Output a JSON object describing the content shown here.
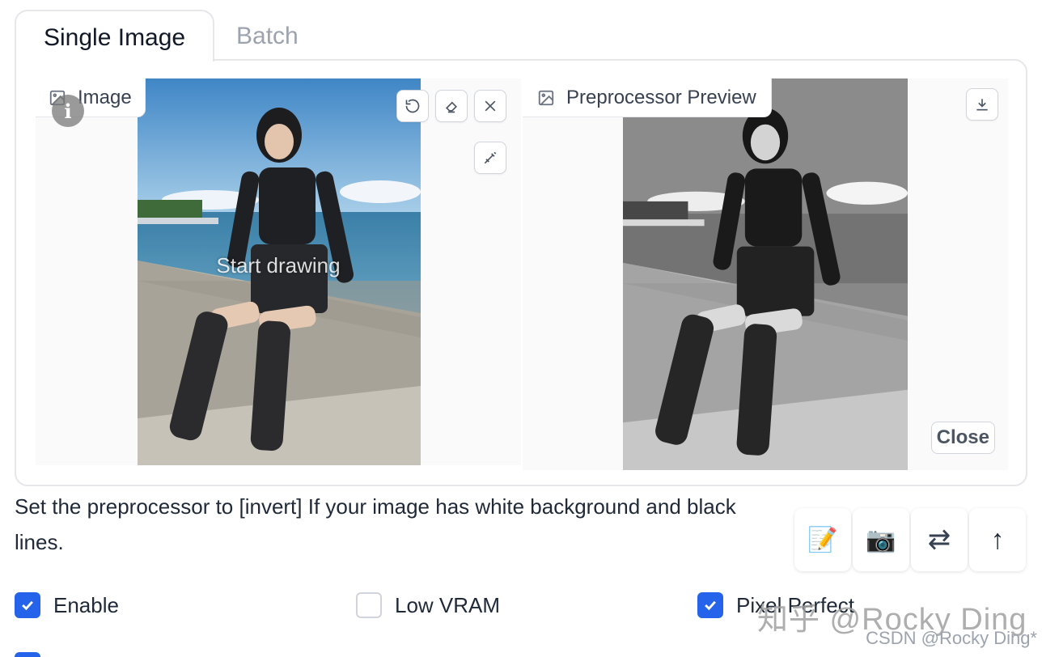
{
  "tabs": [
    {
      "label": "Single Image",
      "active": true
    },
    {
      "label": "Batch",
      "active": false
    }
  ],
  "image_panel": {
    "label": "Image",
    "overlay_text": "Start drawing",
    "info_glyph": "i",
    "tools": [
      "undo-icon",
      "eraser-icon",
      "close-icon",
      "brush-icon"
    ]
  },
  "preview_panel": {
    "label": "Preprocessor Preview",
    "close_label": "Close",
    "tools": [
      "download-icon"
    ]
  },
  "hint": "Set the preprocessor to [invert] If your image has white background and black lines.",
  "actions": [
    {
      "name": "notepad-icon",
      "glyph": "📝"
    },
    {
      "name": "camera-icon",
      "glyph": "📷"
    },
    {
      "name": "swap-icon",
      "glyph": "⇄"
    },
    {
      "name": "upload-arrow-icon",
      "glyph": "↑"
    }
  ],
  "checkboxes": [
    {
      "label": "Enable",
      "checked": true
    },
    {
      "label": "Low VRAM",
      "checked": false
    },
    {
      "label": "Pixel Perfect",
      "checked": true
    }
  ],
  "watermarks": {
    "primary": "知乎 @Rocky Ding",
    "secondary": "CSDN @Rocky Ding*"
  },
  "colors": {
    "accent": "#2563eb",
    "border": "#e5e7eb"
  }
}
